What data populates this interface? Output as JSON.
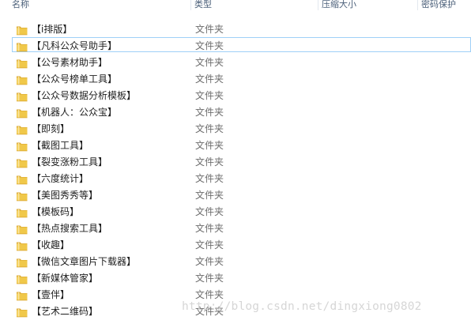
{
  "header": {
    "name": "名称",
    "type": "类型",
    "size": "压缩大小",
    "encrypted": "密码保护"
  },
  "rows": [
    {
      "name": "【i排版】",
      "type": "文件夹"
    },
    {
      "name": "【凡科公众号助手】",
      "type": "文件夹",
      "selected": true
    },
    {
      "name": "【公号素材助手】",
      "type": "文件夹"
    },
    {
      "name": "【公众号榜单工具】",
      "type": "文件夹"
    },
    {
      "name": "【公众号数据分析模板】",
      "type": "文件夹"
    },
    {
      "name": "【机器人：公众宝】",
      "type": "文件夹"
    },
    {
      "name": "【即刻】",
      "type": "文件夹"
    },
    {
      "name": "【截图工具】",
      "type": "文件夹"
    },
    {
      "name": "【裂变涨粉工具】",
      "type": "文件夹"
    },
    {
      "name": "【六度统计】",
      "type": "文件夹"
    },
    {
      "name": "【美图秀秀等】",
      "type": "文件夹"
    },
    {
      "name": "【模板码】",
      "type": "文件夹"
    },
    {
      "name": "【热点搜索工具】",
      "type": "文件夹"
    },
    {
      "name": "【收趣】",
      "type": "文件夹"
    },
    {
      "name": "【微信文章图片下载器】",
      "type": "文件夹"
    },
    {
      "name": "【新媒体管家】",
      "type": "文件夹"
    },
    {
      "name": "【壹伴】",
      "type": "文件夹"
    },
    {
      "name": "【艺术二维码】",
      "type": "文件夹"
    }
  ],
  "watermark": "http://blog.csdn.net/dingxiong0802",
  "colors": {
    "folder_body": "#f0c84a",
    "folder_dark": "#d9a52c",
    "selection_border": "#9fd0f7",
    "header_text": "#4c607a"
  },
  "icons": {
    "folder": "folder-icon"
  }
}
